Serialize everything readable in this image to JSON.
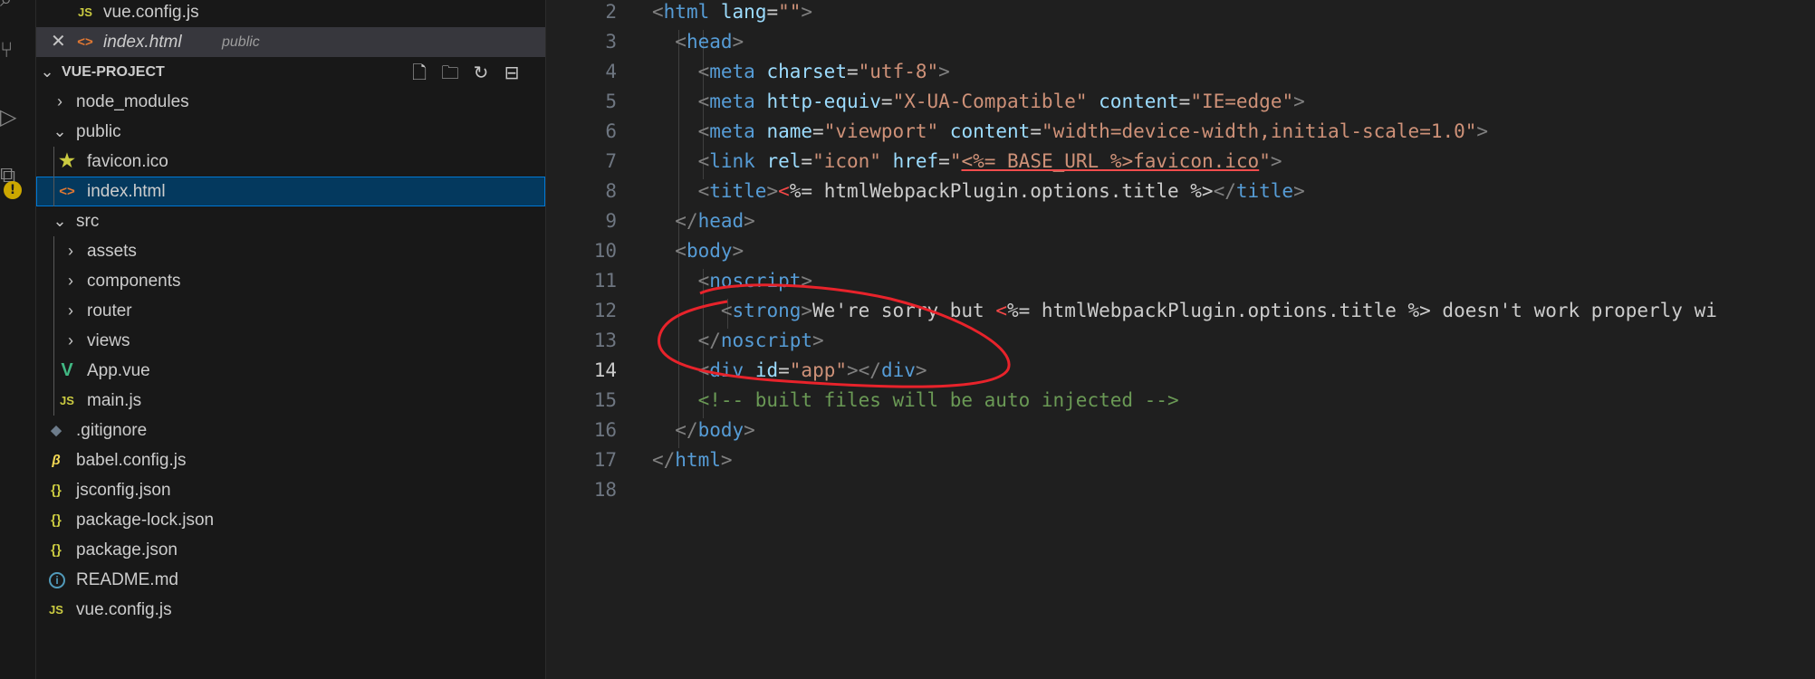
{
  "open_editors": [
    {
      "icon": "JS",
      "name": "vue.config.js",
      "desc": ""
    },
    {
      "icon": "<>",
      "name": "index.html",
      "desc": "public"
    }
  ],
  "explorer": {
    "title": "VUE-PROJECT",
    "items": [
      {
        "label": "node_modules",
        "icon": ""
      },
      {
        "label": "public",
        "icon": ""
      },
      {
        "label": "favicon.ico",
        "icon": "★"
      },
      {
        "label": "index.html",
        "icon": "<>"
      },
      {
        "label": "src",
        "icon": ""
      },
      {
        "label": "assets",
        "icon": ""
      },
      {
        "label": "components",
        "icon": ""
      },
      {
        "label": "router",
        "icon": ""
      },
      {
        "label": "views",
        "icon": ""
      },
      {
        "label": "App.vue",
        "icon": "V"
      },
      {
        "label": "main.js",
        "icon": "JS"
      },
      {
        "label": ".gitignore",
        "icon": "◆"
      },
      {
        "label": "babel.config.js",
        "icon": "β"
      },
      {
        "label": "jsconfig.json",
        "icon": "{}"
      },
      {
        "label": "package-lock.json",
        "icon": "{}"
      },
      {
        "label": "package.json",
        "icon": "{}"
      },
      {
        "label": "README.md",
        "icon": "i"
      },
      {
        "label": "vue.config.js",
        "icon": "JS"
      }
    ]
  },
  "editor": {
    "active_line": "14",
    "lines": [
      {
        "n": "2",
        "tokens": [
          [
            "t",
            "<"
          ],
          [
            "tag",
            "html"
          ],
          [
            "txt",
            " "
          ],
          [
            "attr",
            "lang"
          ],
          [
            "eq",
            "="
          ],
          [
            "str",
            "\"\""
          ],
          [
            "t",
            ">"
          ]
        ]
      },
      {
        "n": "3",
        "tokens": [
          [
            "txt",
            "  "
          ],
          [
            "t",
            "<"
          ],
          [
            "tag",
            "head"
          ],
          [
            "t",
            ">"
          ]
        ]
      },
      {
        "n": "4",
        "tokens": [
          [
            "txt",
            "    "
          ],
          [
            "t",
            "<"
          ],
          [
            "tag",
            "meta"
          ],
          [
            "txt",
            " "
          ],
          [
            "attr",
            "charset"
          ],
          [
            "eq",
            "="
          ],
          [
            "str",
            "\"utf-8\""
          ],
          [
            "t",
            ">"
          ]
        ]
      },
      {
        "n": "5",
        "tokens": [
          [
            "txt",
            "    "
          ],
          [
            "t",
            "<"
          ],
          [
            "tag",
            "meta"
          ],
          [
            "txt",
            " "
          ],
          [
            "attr",
            "http-equiv"
          ],
          [
            "eq",
            "="
          ],
          [
            "str",
            "\"X-UA-Compatible\""
          ],
          [
            "txt",
            " "
          ],
          [
            "attr",
            "content"
          ],
          [
            "eq",
            "="
          ],
          [
            "str",
            "\"IE=edge\""
          ],
          [
            "t",
            ">"
          ]
        ]
      },
      {
        "n": "6",
        "tokens": [
          [
            "txt",
            "    "
          ],
          [
            "t",
            "<"
          ],
          [
            "tag",
            "meta"
          ],
          [
            "txt",
            " "
          ],
          [
            "attr",
            "name"
          ],
          [
            "eq",
            "="
          ],
          [
            "str",
            "\"viewport\""
          ],
          [
            "txt",
            " "
          ],
          [
            "attr",
            "content"
          ],
          [
            "eq",
            "="
          ],
          [
            "str",
            "\"width=device-width,initial-scale=1.0\""
          ],
          [
            "t",
            ">"
          ]
        ]
      },
      {
        "n": "7",
        "tokens": [
          [
            "txt",
            "    "
          ],
          [
            "t",
            "<"
          ],
          [
            "tag",
            "link"
          ],
          [
            "txt",
            " "
          ],
          [
            "attr",
            "rel"
          ],
          [
            "eq",
            "="
          ],
          [
            "str",
            "\"icon\""
          ],
          [
            "txt",
            " "
          ],
          [
            "attr",
            "href"
          ],
          [
            "eq",
            "="
          ],
          [
            "str",
            "\""
          ],
          [
            "sq",
            "<%= BASE_URL %>favicon.ico"
          ],
          [
            "str",
            "\""
          ],
          [
            "t",
            ">"
          ]
        ]
      },
      {
        "n": "8",
        "tokens": [
          [
            "txt",
            "    "
          ],
          [
            "t",
            "<"
          ],
          [
            "tag",
            "title"
          ],
          [
            "t",
            ">"
          ],
          [
            "tmpl",
            "<"
          ],
          [
            "txt",
            "%= htmlWebpackPlugin.options.title %>"
          ],
          [
            "t",
            "</"
          ],
          [
            "tag",
            "title"
          ],
          [
            "t",
            ">"
          ]
        ]
      },
      {
        "n": "9",
        "tokens": [
          [
            "txt",
            "  "
          ],
          [
            "t",
            "</"
          ],
          [
            "tag",
            "head"
          ],
          [
            "t",
            ">"
          ]
        ]
      },
      {
        "n": "10",
        "tokens": [
          [
            "txt",
            "  "
          ],
          [
            "t",
            "<"
          ],
          [
            "tag",
            "body"
          ],
          [
            "t",
            ">"
          ]
        ]
      },
      {
        "n": "11",
        "tokens": [
          [
            "txt",
            "    "
          ],
          [
            "t",
            "<"
          ],
          [
            "tag",
            "noscript"
          ],
          [
            "t",
            ">"
          ]
        ]
      },
      {
        "n": "12",
        "tokens": [
          [
            "txt",
            "      "
          ],
          [
            "t",
            "<"
          ],
          [
            "tag",
            "strong"
          ],
          [
            "t",
            ">"
          ],
          [
            "txt",
            "We're sorry but "
          ],
          [
            "tmpl",
            "<"
          ],
          [
            "txt",
            "%= htmlWebpackPlugin.options.title %> doesn't work properly wi"
          ]
        ]
      },
      {
        "n": "13",
        "tokens": [
          [
            "txt",
            "    "
          ],
          [
            "t",
            "</"
          ],
          [
            "tag",
            "noscript"
          ],
          [
            "t",
            ">"
          ]
        ]
      },
      {
        "n": "14",
        "tokens": [
          [
            "txt",
            "    "
          ],
          [
            "t",
            "<"
          ],
          [
            "tag",
            "div"
          ],
          [
            "txt",
            " "
          ],
          [
            "attr",
            "id"
          ],
          [
            "eq",
            "="
          ],
          [
            "str",
            "\"app\""
          ],
          [
            "t",
            "></"
          ],
          [
            "tag",
            "div"
          ],
          [
            "t",
            ">"
          ]
        ]
      },
      {
        "n": "15",
        "tokens": [
          [
            "txt",
            "    "
          ],
          [
            "cmt",
            "<!-- built files will be auto injected -->"
          ]
        ]
      },
      {
        "n": "16",
        "tokens": [
          [
            "txt",
            "  "
          ],
          [
            "t",
            "</"
          ],
          [
            "tag",
            "body"
          ],
          [
            "t",
            ">"
          ]
        ]
      },
      {
        "n": "17",
        "tokens": [
          [
            "t",
            "</"
          ],
          [
            "tag",
            "html"
          ],
          [
            "t",
            ">"
          ]
        ]
      },
      {
        "n": "18",
        "tokens": []
      }
    ]
  },
  "colors": {
    "annotation": "#e8232b",
    "selection": "#04395e",
    "accent": "#0078d4"
  }
}
